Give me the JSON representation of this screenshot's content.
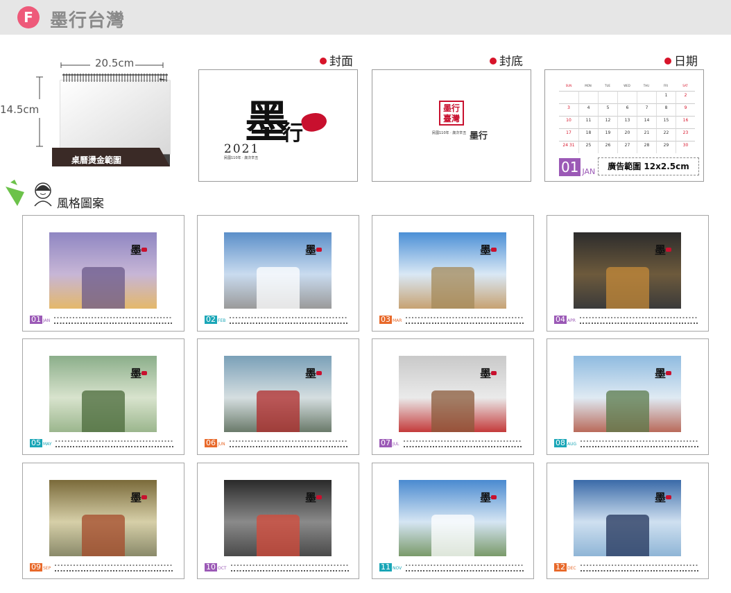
{
  "header": {
    "badge": "F",
    "title": "墨行台灣"
  },
  "desk": {
    "width_label": "20.5cm",
    "height_label": "14.5cm",
    "base_text": "桌曆燙金範圍"
  },
  "sections": {
    "cover": "封面",
    "back": "封底",
    "date": "日期"
  },
  "cover": {
    "year": "2021",
    "calligraphy": "墨",
    "calligraphy2": "行",
    "subtitle": "民國110年 · 歲次辛丑"
  },
  "back": {
    "seal_text": "墨行臺灣",
    "subtitle": "民國110年 · 歲次辛丑",
    "sign": "墨行"
  },
  "date_page": {
    "weekdays": [
      "SUN",
      "MON",
      "TUE",
      "WED",
      "THU",
      "FRI",
      "SAT"
    ],
    "rows": [
      [
        "",
        "",
        "",
        "",
        "",
        "1",
        "2"
      ],
      [
        "3",
        "4",
        "5",
        "6",
        "7",
        "8",
        "9"
      ],
      [
        "10",
        "11",
        "12",
        "13",
        "14",
        "15",
        "16"
      ],
      [
        "17",
        "18",
        "19",
        "20",
        "21",
        "22",
        "23"
      ],
      [
        "24 31",
        "25",
        "26",
        "27",
        "28",
        "29",
        "30"
      ]
    ],
    "month_num": "01",
    "month_name": "JAN",
    "ad_text": "廣告範圍 12x2.5cm"
  },
  "style": {
    "label": "風格圖案"
  },
  "months": [
    {
      "num": "01",
      "name": "JAN",
      "color": "#9b59b6"
    },
    {
      "num": "02",
      "name": "FEB",
      "color": "#1aa6b7"
    },
    {
      "num": "03",
      "name": "MAR",
      "color": "#e8692a"
    },
    {
      "num": "04",
      "name": "APR",
      "color": "#9b59b6"
    },
    {
      "num": "05",
      "name": "MAY",
      "color": "#1aa6b7"
    },
    {
      "num": "06",
      "name": "JUN",
      "color": "#e8692a"
    },
    {
      "num": "07",
      "name": "JUL",
      "color": "#9b59b6"
    },
    {
      "num": "08",
      "name": "AUG",
      "color": "#1aa6b7"
    },
    {
      "num": "09",
      "name": "SEP",
      "color": "#e8692a"
    },
    {
      "num": "10",
      "name": "OCT",
      "color": "#9b59b6"
    },
    {
      "num": "11",
      "name": "NOV",
      "color": "#1aa6b7"
    },
    {
      "num": "12",
      "name": "DEC",
      "color": "#e8692a"
    }
  ],
  "signature": "墨"
}
